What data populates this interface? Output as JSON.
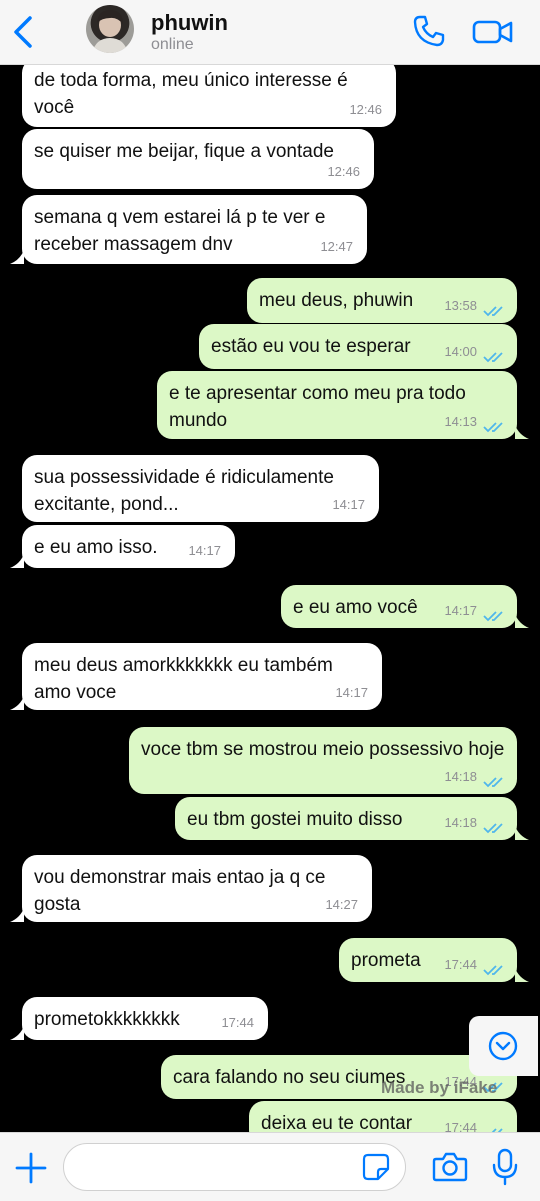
{
  "header": {
    "name": "phuwin",
    "status": "online"
  },
  "messages": [
    {
      "dir": "in",
      "text": "de toda forma, meu único interesse é você",
      "time": "12:46"
    },
    {
      "dir": "in",
      "text": "se quiser me beijar, fique a vontade",
      "time": "12:46"
    },
    {
      "dir": "in",
      "text": "semana q vem estarei lá p te ver e receber massagem dnv",
      "time": "12:47"
    },
    {
      "dir": "out",
      "text": "meu deus, phuwin",
      "time": "13:58"
    },
    {
      "dir": "out",
      "text": "estão eu vou te esperar",
      "time": "14:00"
    },
    {
      "dir": "out",
      "text": "e te apresentar como meu pra todo mundo",
      "time": "14:13"
    },
    {
      "dir": "in",
      "text": "sua possessividade é ridiculamente excitante, pond...",
      "time": "14:17"
    },
    {
      "dir": "in",
      "text": "e eu amo isso.",
      "time": "14:17"
    },
    {
      "dir": "out",
      "text": "e eu amo você",
      "time": "14:17"
    },
    {
      "dir": "in",
      "text": "meu deus amorkkkkkkk eu também amo voce",
      "time": "14:17"
    },
    {
      "dir": "out",
      "text": "voce tbm se mostrou meio possessivo hoje",
      "time": "14:18"
    },
    {
      "dir": "out",
      "text": "eu tbm gostei muito disso",
      "time": "14:18"
    },
    {
      "dir": "in",
      "text": "vou demonstrar mais entao ja q ce gosta",
      "time": "14:27"
    },
    {
      "dir": "out",
      "text": "prometa",
      "time": "17:44"
    },
    {
      "dir": "in",
      "text": "prometokkkkkkkk",
      "time": "17:44"
    },
    {
      "dir": "out",
      "text": "cara falando no seu ciumes",
      "time": "17:44"
    },
    {
      "dir": "out",
      "text": "deixa eu te contar",
      "time": "17:44"
    }
  ],
  "watermark": "Made by iFake",
  "composer": {
    "placeholder": ""
  },
  "colors": {
    "accent": "#007aff",
    "outgoing": "#dcf8c6",
    "incoming": "#ffffff",
    "read_ticks": "#4fb6ec"
  }
}
